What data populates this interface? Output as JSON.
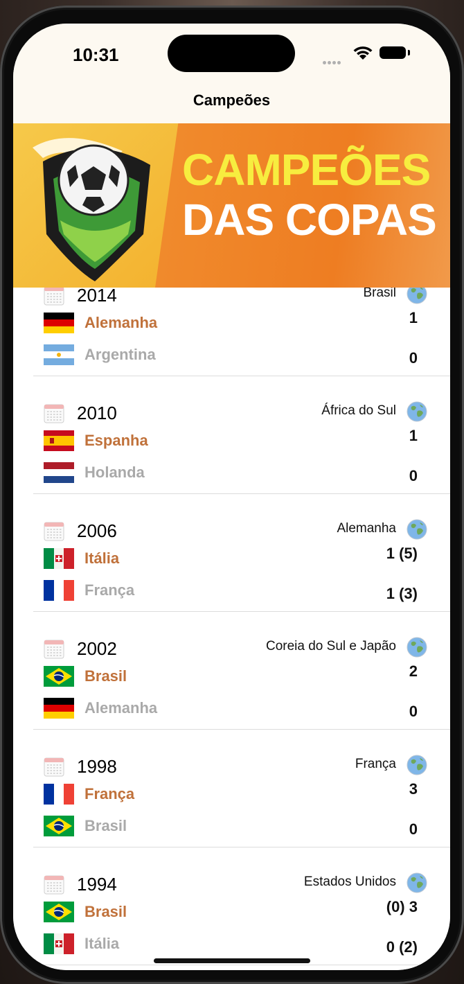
{
  "status_bar": {
    "time": "10:31"
  },
  "nav": {
    "title": "Campeões"
  },
  "banner": {
    "line1": "CAMPEÕES",
    "line2": "DAS COPAS"
  },
  "matches": [
    {
      "year": "2014",
      "host": "Brasil",
      "winner": "Alemanha",
      "winner_flag": "germany",
      "winner_score": "1",
      "runner_up": "Argentina",
      "runner_flag": "argentina",
      "runner_score": "0"
    },
    {
      "year": "2010",
      "host": "África do Sul",
      "winner": "Espanha",
      "winner_flag": "spain",
      "winner_score": "1",
      "runner_up": "Holanda",
      "runner_flag": "netherlands",
      "runner_score": "0"
    },
    {
      "year": "2006",
      "host": "Alemanha",
      "winner": "Itália",
      "winner_flag": "italy",
      "winner_score": "1 (5)",
      "runner_up": "França",
      "runner_flag": "france",
      "runner_score": "1 (3)"
    },
    {
      "year": "2002",
      "host": "Coreia do Sul e Japão",
      "winner": "Brasil",
      "winner_flag": "brazil",
      "winner_score": "2",
      "runner_up": "Alemanha",
      "runner_flag": "germany",
      "runner_score": "0"
    },
    {
      "year": "1998",
      "host": "França",
      "winner": "França",
      "winner_flag": "france",
      "winner_score": "3",
      "runner_up": "Brasil",
      "runner_flag": "brazil",
      "runner_score": "0"
    },
    {
      "year": "1994",
      "host": "Estados Unidos",
      "winner": "Brasil",
      "winner_flag": "brazil",
      "winner_score": "(0) 3",
      "runner_up": "Itália",
      "runner_flag": "italy",
      "runner_score": "0 (2)"
    }
  ],
  "icons": {
    "calendar": "calendar-icon",
    "host": "globe-icon"
  },
  "colors": {
    "winner": "#c0713a",
    "runner_up": "#a9a9a9",
    "banner_orange": "#ee7d22",
    "banner_yellow": "#f7ed3f"
  }
}
